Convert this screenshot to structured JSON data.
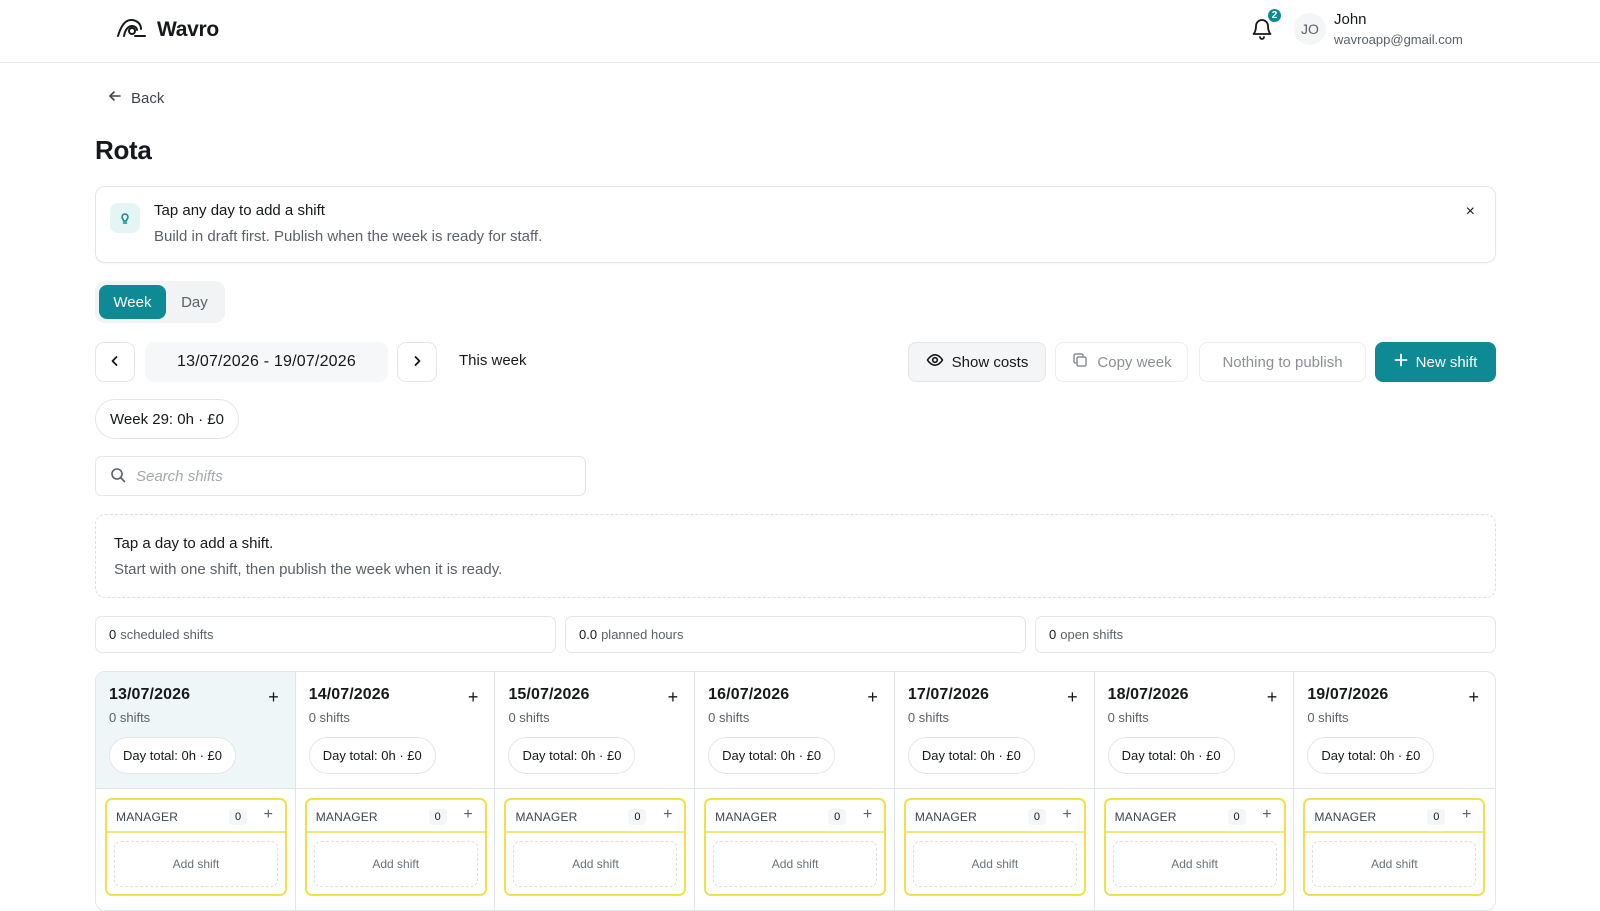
{
  "app": {
    "name": "Wavro"
  },
  "header": {
    "notification_count": "2",
    "user": {
      "initials": "JO",
      "name": "John",
      "email": "wavroapp@gmail.com"
    }
  },
  "nav": {
    "back_label": "Back"
  },
  "page": {
    "title": "Rota"
  },
  "tip": {
    "title": "Tap any day to add a shift",
    "subtitle": "Build in draft first. Publish when the week is ready for staff.",
    "close_symbol": "×"
  },
  "view_toggle": {
    "options": [
      "Week",
      "Day"
    ],
    "active": "Week"
  },
  "date_nav": {
    "range": "13/07/2026 - 19/07/2026",
    "this_week_label": "This week"
  },
  "toolbar": {
    "show_costs": "Show costs",
    "copy_week": "Copy week",
    "publish": "Nothing to publish",
    "new_shift": "New shift"
  },
  "week_summary": "Week 29: 0h · £0",
  "search": {
    "placeholder": "Search shifts",
    "value": ""
  },
  "empty_state": {
    "title": "Tap a day to add a shift.",
    "subtitle": "Start with one shift, then publish the week when it is ready."
  },
  "stats": [
    {
      "value": "0",
      "label": "scheduled shifts"
    },
    {
      "value": "0.0",
      "label": "planned hours"
    },
    {
      "value": "0",
      "label": "open shifts"
    }
  ],
  "days": [
    {
      "date": "13/07/2026",
      "shifts": "0 shifts",
      "total": "Day total: 0h · £0",
      "role": "MANAGER",
      "role_count": "0",
      "add_label": "Add shift",
      "today": true
    },
    {
      "date": "14/07/2026",
      "shifts": "0 shifts",
      "total": "Day total: 0h · £0",
      "role": "MANAGER",
      "role_count": "0",
      "add_label": "Add shift"
    },
    {
      "date": "15/07/2026",
      "shifts": "0 shifts",
      "total": "Day total: 0h · £0",
      "role": "MANAGER",
      "role_count": "0",
      "add_label": "Add shift"
    },
    {
      "date": "16/07/2026",
      "shifts": "0 shifts",
      "total": "Day total: 0h · £0",
      "role": "MANAGER",
      "role_count": "0",
      "add_label": "Add shift"
    },
    {
      "date": "17/07/2026",
      "shifts": "0 shifts",
      "total": "Day total: 0h · £0",
      "role": "MANAGER",
      "role_count": "0",
      "add_label": "Add shift"
    },
    {
      "date": "18/07/2026",
      "shifts": "0 shifts",
      "total": "Day total: 0h · £0",
      "role": "MANAGER",
      "role_count": "0",
      "add_label": "Add shift"
    },
    {
      "date": "19/07/2026",
      "shifts": "0 shifts",
      "total": "Day total: 0h · £0",
      "role": "MANAGER",
      "role_count": "0",
      "add_label": "Add shift"
    }
  ],
  "icons": {
    "logo": "wavro-logo-icon",
    "bell": "bell-icon",
    "back": "arrow-left-icon",
    "tip": "lightbulb-icon",
    "prev": "chevron-left-icon",
    "next": "chevron-right-icon",
    "eye": "eye-icon",
    "copy": "copy-icon",
    "plus": "plus-icon",
    "search": "search-icon"
  },
  "colors": {
    "accent": "#0e8a94",
    "role_border": "#f2e04a",
    "today_bg": "#eef6f8"
  }
}
